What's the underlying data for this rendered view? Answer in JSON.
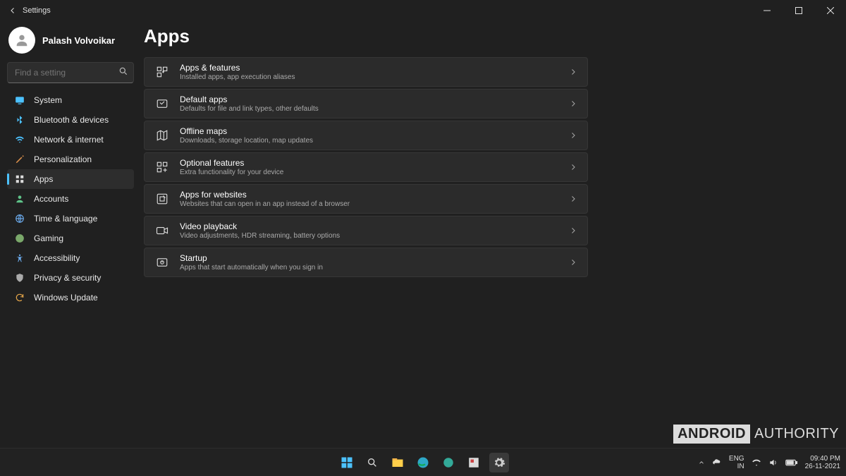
{
  "window": {
    "title": "Settings",
    "user_name": "Palash Volvoikar"
  },
  "search": {
    "placeholder": "Find a setting"
  },
  "sidebar": {
    "items": [
      {
        "label": "System",
        "icon": "system-icon",
        "active": false
      },
      {
        "label": "Bluetooth & devices",
        "icon": "bluetooth-icon",
        "active": false
      },
      {
        "label": "Network & internet",
        "icon": "network-icon",
        "active": false
      },
      {
        "label": "Personalization",
        "icon": "personalization-icon",
        "active": false
      },
      {
        "label": "Apps",
        "icon": "apps-icon",
        "active": true
      },
      {
        "label": "Accounts",
        "icon": "accounts-icon",
        "active": false
      },
      {
        "label": "Time & language",
        "icon": "time-language-icon",
        "active": false
      },
      {
        "label": "Gaming",
        "icon": "gaming-icon",
        "active": false
      },
      {
        "label": "Accessibility",
        "icon": "accessibility-icon",
        "active": false
      },
      {
        "label": "Privacy & security",
        "icon": "privacy-icon",
        "active": false
      },
      {
        "label": "Windows Update",
        "icon": "windows-update-icon",
        "active": false
      }
    ]
  },
  "page": {
    "heading": "Apps",
    "cards": [
      {
        "title": "Apps & features",
        "subtitle": "Installed apps, app execution aliases",
        "icon": "apps-features-icon"
      },
      {
        "title": "Default apps",
        "subtitle": "Defaults for file and link types, other defaults",
        "icon": "default-apps-icon"
      },
      {
        "title": "Offline maps",
        "subtitle": "Downloads, storage location, map updates",
        "icon": "offline-maps-icon"
      },
      {
        "title": "Optional features",
        "subtitle": "Extra functionality for your device",
        "icon": "optional-features-icon"
      },
      {
        "title": "Apps for websites",
        "subtitle": "Websites that can open in an app instead of a browser",
        "icon": "apps-websites-icon"
      },
      {
        "title": "Video playback",
        "subtitle": "Video adjustments, HDR streaming, battery options",
        "icon": "video-playback-icon"
      },
      {
        "title": "Startup",
        "subtitle": "Apps that start automatically when you sign in",
        "icon": "startup-icon"
      }
    ]
  },
  "tray": {
    "lang1": "ENG",
    "lang2": "IN",
    "time": "09:40 PM",
    "date": "26-11-2021"
  },
  "watermark": {
    "box": "ANDROID",
    "rest": "AUTHORITY"
  }
}
